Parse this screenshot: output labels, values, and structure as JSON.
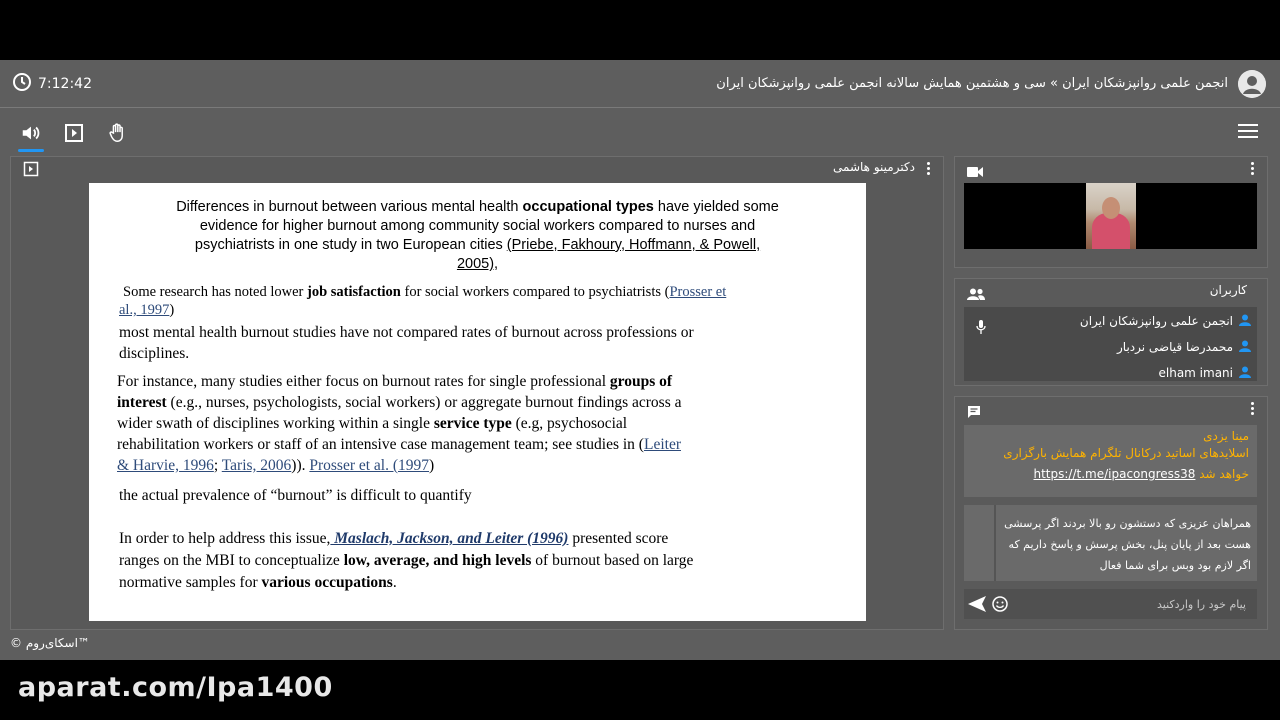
{
  "header": {
    "time": "7:12:42",
    "title": "انجمن علمی روانپزشکان ایران » سی و هشتمین همایش سالانه انجمن علمی روانپزشکان ایران"
  },
  "stage": {
    "presenter": "دکترمینو هاشمی"
  },
  "slide": {
    "heading_1": "Differences in burnout between various mental health ",
    "heading_bold": "occupational types",
    "heading_2": " have yielded some",
    "heading_3": "evidence for higher burnout among community social workers compared to nurses and",
    "heading_4": "psychiatrists in one study in two European cities   ",
    "heading_cite": "(Priebe, Fakhoury, Hoffmann, & Powell,",
    "heading_cite_2": "2005)",
    "heading_end": ",",
    "p1_a": "Some research has noted lower ",
    "p1_bold": "job satisfaction",
    "p1_b": " for social workers compared to psychiatrists (",
    "p1_link_1": "Prosser et",
    "p1_link_2": "al., 1997",
    "p1_c": ")",
    "p2_line1": "most mental health burnout studies have not compared rates of burnout across professions or",
    "p2_line2": "disciplines.",
    "p3_a": "For instance, many studies either focus on burnout rates for single professional ",
    "p3_bold_1": "groups of",
    "p3_bold_2": "interest",
    "p3_b": " (e.g., nurses, psychologists, social workers) or aggregate burnout findings across a",
    "p3_c": "wider swath of disciplines working within a single ",
    "p3_bold_3": "service type",
    "p3_d": " (e.g, psychosocial",
    "p3_e": "rehabilitation workers or staff of an intensive case management team; see studies in (",
    "p3_link_1": "Leiter",
    "p3_link_2": "& Harvie, 1996",
    "p3_sep": "; ",
    "p3_link_3": "Taris, 2006",
    "p3_f": ")). ",
    "p3_link_4": "Prosser et al. (1997",
    "p3_g": ")",
    "p4": "the actual prevalence of “burnout” is difficult to quantify",
    "p5_a": "In order to help address this issue,",
    "p5_link": " Maslach, Jackson, and Leiter (1996)",
    "p5_b": " presented score",
    "p5_c": "ranges on the MBI to conceptualize ",
    "p5_bold_1": "low, average, and high levels",
    "p5_d": " of burnout based on large",
    "p5_e": "normative samples for ",
    "p5_bold_2": "various occupations",
    "p5_f": "."
  },
  "users": {
    "label": "کاربران",
    "items": [
      {
        "name": "انجمن علمی روانپزشکان ایران"
      },
      {
        "name": "محمدرضا قیاضی نردبار"
      },
      {
        "name": "elham imani"
      }
    ]
  },
  "chat": {
    "message": {
      "author": "مینا یزدی",
      "line1": "اسلایدهای اساتید درکانال تلگرام همایش بارگزاری",
      "line2_prefix": "خواهد شد ",
      "url": "https://t.me/ipacongress38"
    },
    "notice": "همراهان عزیزی که دستشون رو بالا بردند اگر پرسشی هست بعد از پایان پنل، بخش پرسش و پاسخ داریم که اگر لازم بود وبس برای شما فعال",
    "input_placeholder": "پیام خود را واردکنید"
  },
  "footer": {
    "brand": "© اسکای‌روم™"
  },
  "watermark": "aparat.com/Ipa1400",
  "colors": {
    "accent": "#2196f3",
    "chat_author": "#ffb300",
    "panel_bg": "#5e5e5e"
  }
}
